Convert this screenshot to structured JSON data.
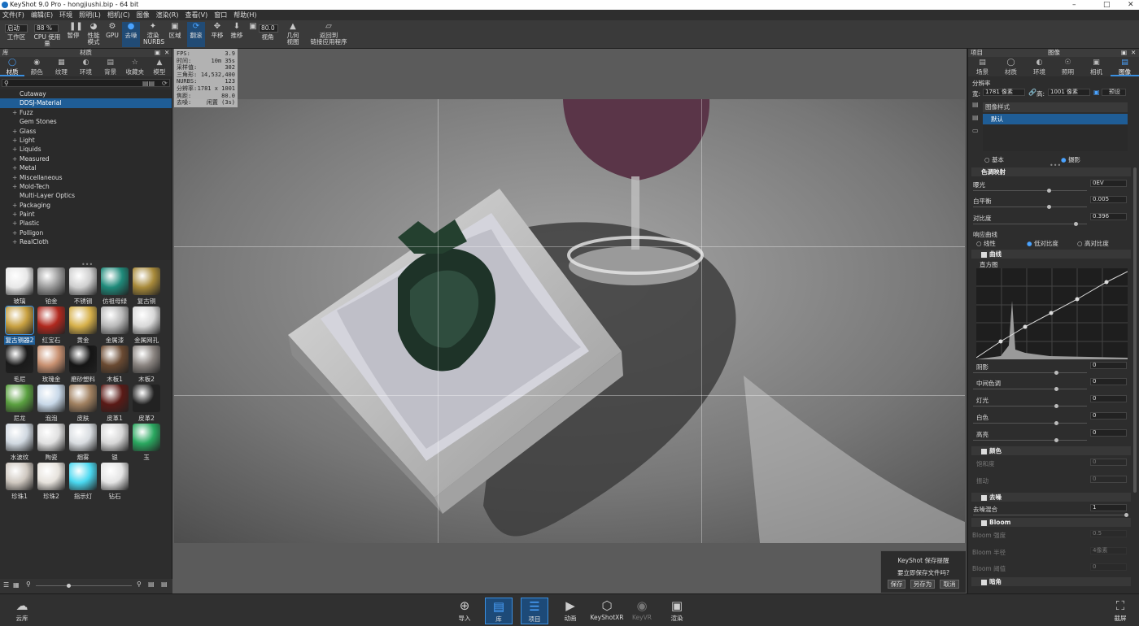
{
  "window": {
    "title": "KeyShot 9.0 Pro  -  hongjiushi.bip  -  64 bit"
  },
  "menu": [
    "文件(F)",
    "编辑(E)",
    "环境",
    "照明(L)",
    "相机(C)",
    "图像",
    "渲染(R)",
    "查看(V)",
    "窗口",
    "帮助(H)"
  ],
  "toolbar": {
    "workspace_value": "启动",
    "workspace_label": "工作区",
    "cpu_value": "88 %",
    "cpu_label": "CPU 使用量",
    "pause": "暂停",
    "perf_mode": "性能\n模式",
    "gpu": "GPU",
    "denoise": "去噪",
    "nurbs": "渲染\nNURBS",
    "region": "区域",
    "tumble": "翻滚",
    "pan": "平移",
    "dolly": "推移",
    "fov_value": "80.0",
    "fov_label": "视角",
    "geometry_view": "几何\n视图",
    "link_back": "返回到\n链接应用程序"
  },
  "library": {
    "panel_title": "材质",
    "side_label": "库",
    "tabs": [
      "材质",
      "颜色",
      "纹理",
      "环境",
      "背景",
      "收藏夹",
      "模型"
    ],
    "tree": [
      {
        "label": "Cutaway",
        "plus": false
      },
      {
        "label": "DDSJ-Material",
        "plus": false,
        "selected": true
      },
      {
        "label": "Fuzz",
        "plus": true
      },
      {
        "label": "Gem Stones",
        "plus": false
      },
      {
        "label": "Glass",
        "plus": true
      },
      {
        "label": "Light",
        "plus": true
      },
      {
        "label": "Liquids",
        "plus": true
      },
      {
        "label": "Measured",
        "plus": true
      },
      {
        "label": "Metal",
        "plus": true
      },
      {
        "label": "Miscellaneous",
        "plus": true
      },
      {
        "label": "Mold-Tech",
        "plus": true
      },
      {
        "label": "Multi-Layer Optics",
        "plus": false
      },
      {
        "label": "Packaging",
        "plus": true
      },
      {
        "label": "Paint",
        "plus": true
      },
      {
        "label": "Plastic",
        "plus": true
      },
      {
        "label": "Polligon",
        "plus": true
      },
      {
        "label": "RealCloth",
        "plus": true
      }
    ],
    "swatches": [
      {
        "label": "玻璃",
        "color": "#e8e8e8"
      },
      {
        "label": "铂金",
        "color": "#9a9a9a"
      },
      {
        "label": "不锈钢",
        "color": "#cfcfcf"
      },
      {
        "label": "仿祖母绿",
        "color": "#1f8a7a"
      },
      {
        "label": "复古铜",
        "color": "#a88a3a"
      },
      {
        "label": "复古铜器2",
        "color": "#c8a040",
        "selected": true
      },
      {
        "label": "红宝石",
        "color": "#b0281e"
      },
      {
        "label": "黄金",
        "color": "#d6b04a"
      },
      {
        "label": "金属漆",
        "color": "#b8b8b8"
      },
      {
        "label": "金属网孔",
        "color": "#d8d8d8"
      },
      {
        "label": "毛尼",
        "color": "#1a1a1a"
      },
      {
        "label": "玫瑰金",
        "color": "#c89070"
      },
      {
        "label": "磨砂塑料",
        "color": "#151515"
      },
      {
        "label": "木板1",
        "color": "#6a4a32"
      },
      {
        "label": "木板2",
        "color": "#8a8480"
      },
      {
        "label": "尼龙",
        "color": "#5aa040"
      },
      {
        "label": "泡泡",
        "color": "#c8d8e8"
      },
      {
        "label": "皮肤",
        "color": "#a08060"
      },
      {
        "label": "皮革1",
        "color": "#5a1a16"
      },
      {
        "label": "皮革2",
        "color": "#222222"
      },
      {
        "label": "水波纹",
        "color": "#d0d8e0"
      },
      {
        "label": "陶瓷",
        "color": "#e0e0e0"
      },
      {
        "label": "烟雾",
        "color": "#d8dce0"
      },
      {
        "label": "银",
        "color": "#d6d6d6"
      },
      {
        "label": "玉",
        "color": "#2aa860"
      },
      {
        "label": "珍珠1",
        "color": "#cfc8c0"
      },
      {
        "label": "珍珠2",
        "color": "#e6e2dc"
      },
      {
        "label": "指示灯",
        "color": "#4ad8f0"
      },
      {
        "label": "钻石",
        "color": "#e4e4e4"
      }
    ]
  },
  "stats": [
    {
      "k": "FPS:",
      "v": "3.9"
    },
    {
      "k": "时间:",
      "v": "10m 35s"
    },
    {
      "k": "采样值:",
      "v": "302"
    },
    {
      "k": "三角形:",
      "v": "14,532,400"
    },
    {
      "k": "NURBS:",
      "v": "123"
    },
    {
      "k": "分辨率:",
      "v": "1781 x 1001"
    },
    {
      "k": "焦距:",
      "v": "80.0"
    },
    {
      "k": "去噪:",
      "v": "闲置 (3s)"
    }
  ],
  "save_dialog": {
    "title": "KeyShot 保存提醒",
    "message": "要立即保存文件吗?",
    "save": "保存",
    "save_as": "另存为",
    "cancel": "取消"
  },
  "project": {
    "side_label": "项目",
    "panel_title": "图像",
    "tabs": [
      "场景",
      "材质",
      "环境",
      "照明",
      "相机",
      "图像"
    ],
    "resolution_label": "分辨率",
    "width_label": "宽:",
    "width_value": "1781 像素",
    "height_label": "高:",
    "height_value": "1001 像素",
    "preset": "预设",
    "image_style_label": "图像样式",
    "image_style_value": "默认",
    "mode_basic": "基本",
    "mode_photo": "摄影",
    "tonemap_label": "色调映射",
    "exposure_label": "曝光",
    "exposure_value": "0EV",
    "exposure_pos": 0.66,
    "wb_label": "白平衡",
    "wb_value": "0.005",
    "wb_pos": 0.66,
    "contrast_label": "对比度",
    "contrast_value": "0.396",
    "contrast_pos": 0.9,
    "curve_label": "响应曲线",
    "curve_linear": "线性",
    "curve_low": "低对比度",
    "curve_high": "高对比度",
    "curves_section": "曲线",
    "histogram_label": "直方图",
    "shadow_label": "阴影",
    "shadow_value": "0",
    "mid_label": "中间色调",
    "mid_value": "0",
    "light_label": "灯光",
    "light_value": "0",
    "white_label": "白色",
    "white_value": "0",
    "high_label": "高亮",
    "high_value": "0",
    "color_section": "颜色",
    "saturation_label": "饱和度",
    "saturation_value": "0",
    "vibrance_label": "振动",
    "vibrance_value": "0",
    "denoise_section": "去噪",
    "denoise_blend_label": "去噪混合",
    "denoise_blend_value": "1",
    "bloom_section": "Bloom",
    "bloom_intensity_label": "Bloom 强度",
    "bloom_intensity_value": "0.5",
    "bloom_radius_label": "Bloom 半径",
    "bloom_radius_value": "4像素",
    "bloom_threshold_label": "Bloom 阈值",
    "bloom_threshold_value": "0",
    "vignette_section": "暗角"
  },
  "bottombar": {
    "cloud": "云库",
    "import": "导入",
    "library": "库",
    "project": "项目",
    "animation": "动画",
    "keyshotxr": "KeyShotXR",
    "keyvr": "KeyVR",
    "render": "渲染",
    "screenshot": "截屏"
  }
}
